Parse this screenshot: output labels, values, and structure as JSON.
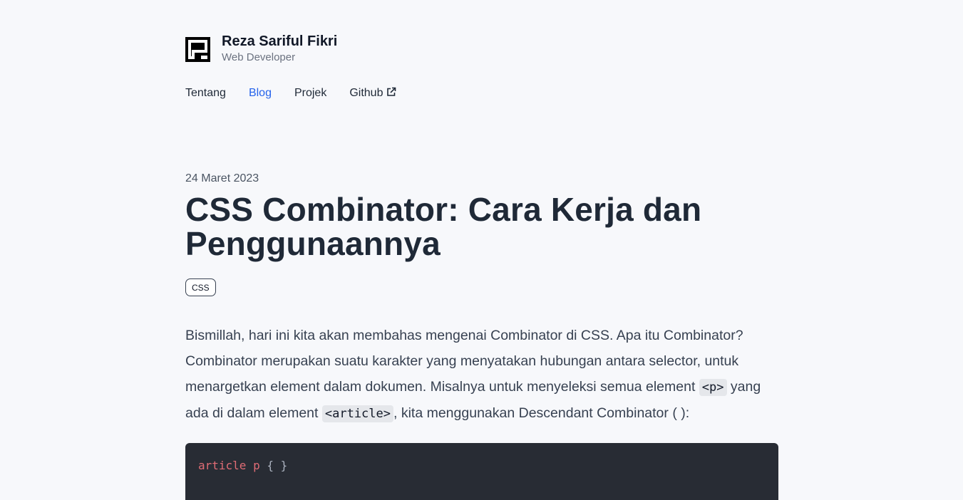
{
  "header": {
    "name": "Reza Sariful Fikri",
    "role": "Web Developer",
    "logo_icon": "logo-icon"
  },
  "nav": {
    "items": [
      {
        "label": "Tentang",
        "active": false
      },
      {
        "label": "Blog",
        "active": true
      },
      {
        "label": "Projek",
        "active": false
      },
      {
        "label": "Github",
        "active": false,
        "icon": "external-link-icon"
      }
    ]
  },
  "article": {
    "date": "24 Maret 2023",
    "title": "CSS Combinator: Cara Kerja dan Penggunaannya",
    "tags": [
      "CSS"
    ],
    "intro": {
      "part1": "Bismillah, hari ini kita akan membahas mengenai Combinator di CSS. Apa itu Combinator? Combinator merupakan suatu karakter yang menyatakan hubungan antara selector, untuk menargetkan element dalam dokumen. Misalnya untuk menyeleksi semua element ",
      "code1": "<p>",
      "part2": " yang ada di dalam element ",
      "code2": "<article>",
      "part3": ", kita menggunakan Descendant Combinator ( ):"
    },
    "code_block": {
      "selector": "article p",
      "braces": " { }"
    }
  },
  "colors": {
    "background": "#f7f8fb",
    "accent": "#2563eb",
    "code_bg": "#282c34",
    "code_selector": "#e06c75"
  }
}
